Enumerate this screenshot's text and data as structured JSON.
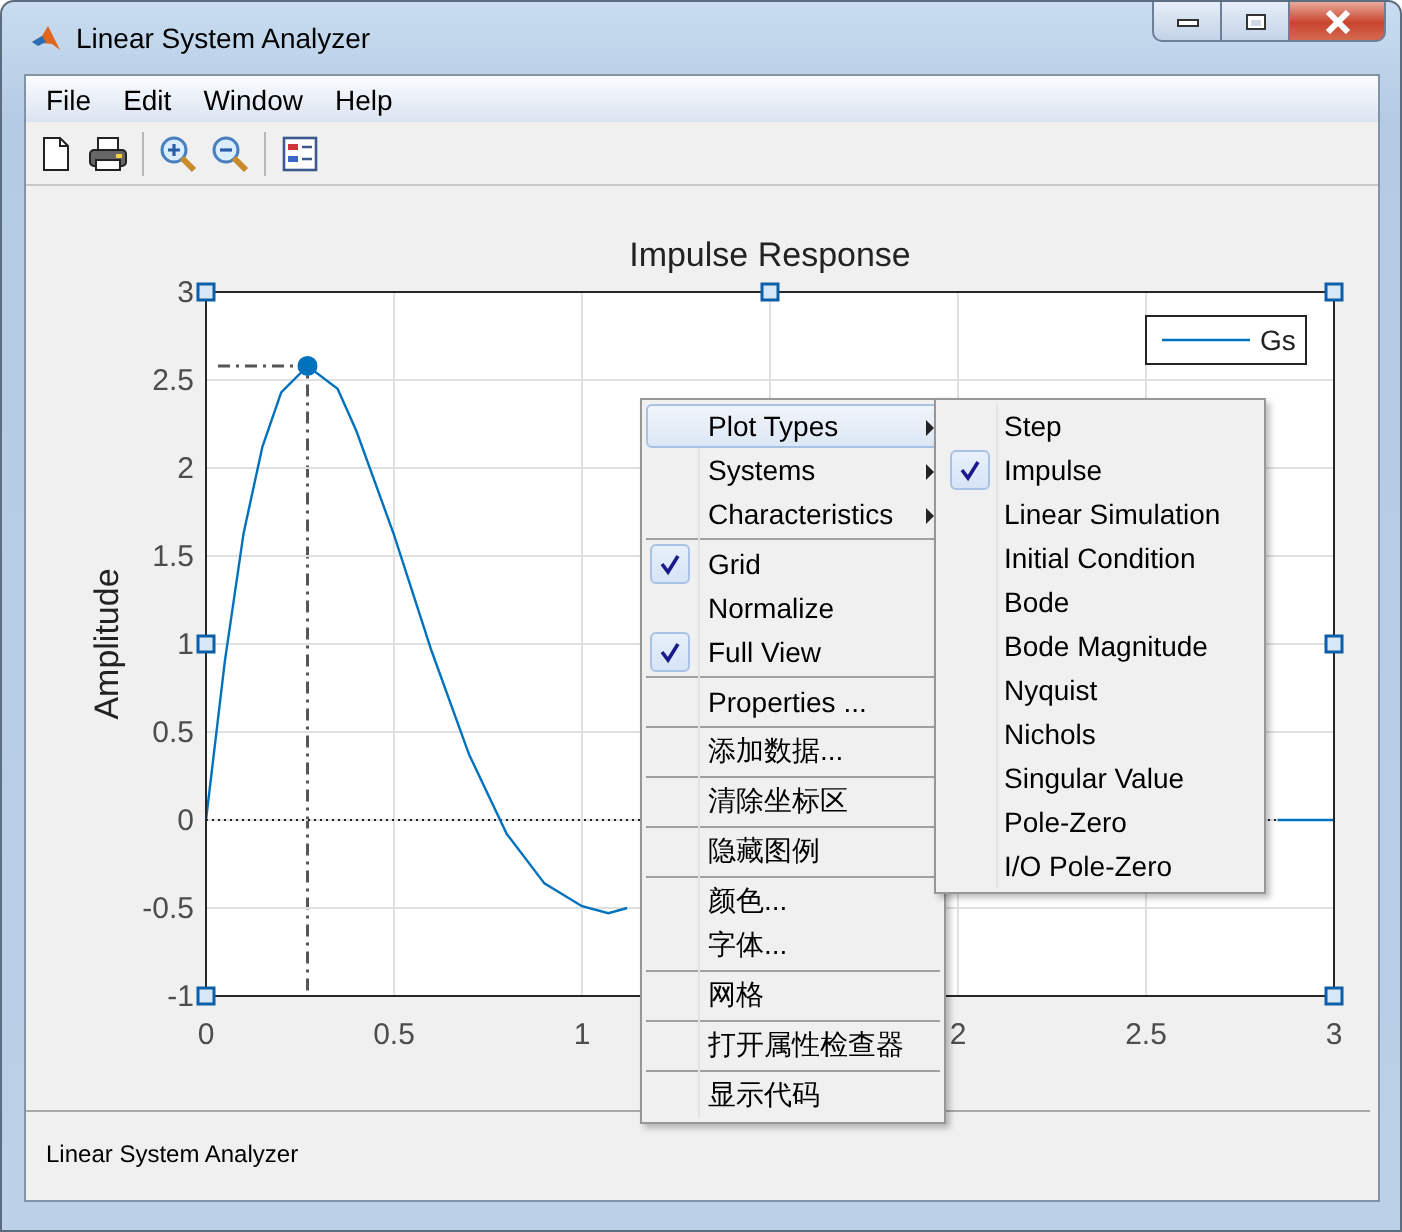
{
  "window": {
    "title": "Linear System Analyzer"
  },
  "menu_bar": [
    "File",
    "Edit",
    "Window",
    "Help"
  ],
  "plot": {
    "selected": true,
    "chart_data": {
      "type": "line",
      "title": "Impulse Response",
      "ylabel": "Amplitude",
      "x": [
        0,
        0.05,
        0.1,
        0.15,
        0.2,
        0.27,
        0.35,
        0.4,
        0.5,
        0.6,
        0.7,
        0.8,
        0.9,
        1.0,
        1.07,
        1.12,
        2.0,
        2.85,
        3.0
      ],
      "series": [
        {
          "name": "Gs",
          "color": "#0072bd",
          "values": [
            0,
            0.9,
            1.63,
            2.12,
            2.43,
            2.58,
            2.45,
            2.21,
            1.62,
            0.96,
            0.37,
            -0.08,
            -0.36,
            -0.49,
            -0.53,
            -0.5,
            null,
            0,
            0
          ]
        }
      ],
      "xlim": [
        0,
        3
      ],
      "ylim": [
        -1,
        3
      ],
      "xticks": [
        0,
        0.5,
        1,
        2,
        2.5,
        3
      ],
      "yticks": [
        -1,
        -0.5,
        0,
        0.5,
        1,
        1.5,
        2,
        2.5,
        3
      ],
      "grid": true,
      "ref_lines": [
        {
          "axis": "y",
          "value": 0
        }
      ]
    }
  },
  "context_menu": {
    "groups": [
      [
        {
          "label": "Plot Types",
          "kind": "submenu",
          "selected": true
        },
        {
          "label": "Systems",
          "kind": "submenu",
          "selected": false
        },
        {
          "label": "Characteristics",
          "kind": "submenu",
          "selected": false
        }
      ],
      [
        {
          "label": "Grid",
          "kind": "check",
          "checked": true,
          "selected": false
        },
        {
          "label": "Normalize",
          "kind": "check",
          "checked": false,
          "selected": false
        },
        {
          "label": "Full View",
          "kind": "check",
          "checked": true,
          "selected": false
        }
      ],
      [
        {
          "label": "Properties ...",
          "kind": "command",
          "selected": false
        }
      ],
      [
        {
          "label": "添加数据...",
          "kind": "command",
          "selected": false
        }
      ],
      [
        {
          "label": "清除坐标区",
          "kind": "command",
          "selected": false
        }
      ],
      [
        {
          "label": "隐藏图例",
          "kind": "command",
          "selected": false
        }
      ],
      [
        {
          "label": "颜色...",
          "kind": "command",
          "selected": false
        },
        {
          "label": "字体...",
          "kind": "command",
          "selected": false
        }
      ],
      [
        {
          "label": "网格",
          "kind": "command",
          "selected": false
        }
      ],
      [
        {
          "label": "打开属性检查器",
          "kind": "command",
          "selected": false
        }
      ],
      [
        {
          "label": "显示代码",
          "kind": "command",
          "selected": false
        }
      ]
    ]
  },
  "submenu": {
    "items": [
      {
        "label": "Step",
        "checked": false
      },
      {
        "label": "Impulse",
        "checked": true
      },
      {
        "label": "Linear Simulation",
        "checked": false
      },
      {
        "label": "Initial Condition",
        "checked": false
      },
      {
        "label": "Bode",
        "checked": false
      },
      {
        "label": "Bode Magnitude",
        "checked": false
      },
      {
        "label": "Nyquist",
        "checked": false
      },
      {
        "label": "Nichols",
        "checked": false
      },
      {
        "label": "Singular Value",
        "checked": false
      },
      {
        "label": "Pole-Zero",
        "checked": false
      },
      {
        "label": "I/O Pole-Zero",
        "checked": false
      }
    ]
  },
  "status_bar": "Linear System Analyzer"
}
